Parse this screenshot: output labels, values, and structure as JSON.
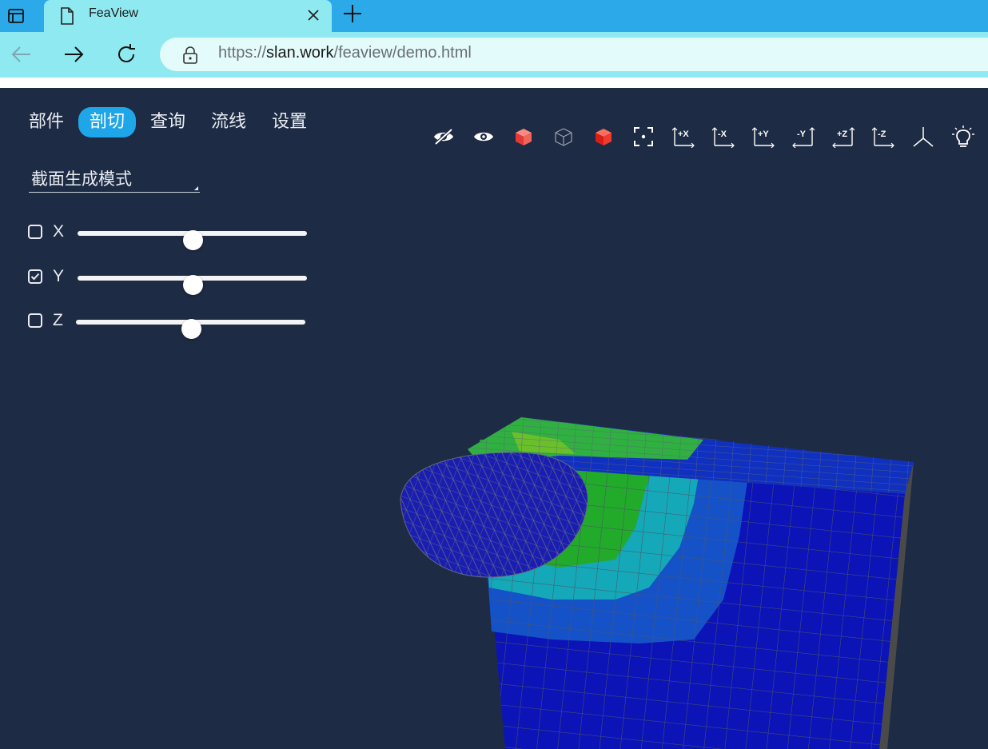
{
  "browser": {
    "tab_title": "FeaView",
    "url_scheme": "https://",
    "url_host": "slan.work",
    "url_path": "/feaview/demo.html"
  },
  "menu": {
    "items": [
      {
        "label": "部件",
        "active": false
      },
      {
        "label": "剖切",
        "active": true
      },
      {
        "label": "查询",
        "active": false
      },
      {
        "label": "流线",
        "active": false
      },
      {
        "label": "设置",
        "active": false
      }
    ]
  },
  "section": {
    "mode_value": "截面生成模式",
    "axes": [
      {
        "label": "X",
        "checked": false,
        "position": 0.5
      },
      {
        "label": "Y",
        "checked": true,
        "position": 0.5
      },
      {
        "label": "Z",
        "checked": false,
        "position": 0.5
      }
    ]
  },
  "toolbar": {
    "tools": [
      {
        "name": "hide-icon",
        "text": ""
      },
      {
        "name": "show-icon",
        "text": ""
      },
      {
        "name": "solid-cube-icon",
        "text": ""
      },
      {
        "name": "wireframe-cube-icon",
        "text": ""
      },
      {
        "name": "shaded-cube-icon",
        "text": ""
      },
      {
        "name": "fit-view-icon",
        "text": ""
      },
      {
        "name": "view-plus-x-icon",
        "text": "+X"
      },
      {
        "name": "view-minus-x-icon",
        "text": "-X"
      },
      {
        "name": "view-plus-y-icon",
        "text": "+Y"
      },
      {
        "name": "view-minus-y-icon",
        "text": "-Y"
      },
      {
        "name": "view-plus-z-icon",
        "text": "+Z"
      },
      {
        "name": "view-minus-z-icon",
        "text": "-Z"
      },
      {
        "name": "isometric-axes-icon",
        "text": ""
      },
      {
        "name": "light-bulb-icon",
        "text": ""
      }
    ]
  },
  "colors": {
    "accent": "#1fa6e8",
    "background": "#1e2b44",
    "contour_low": "#0a15b8",
    "contour_high": "#e03020"
  }
}
